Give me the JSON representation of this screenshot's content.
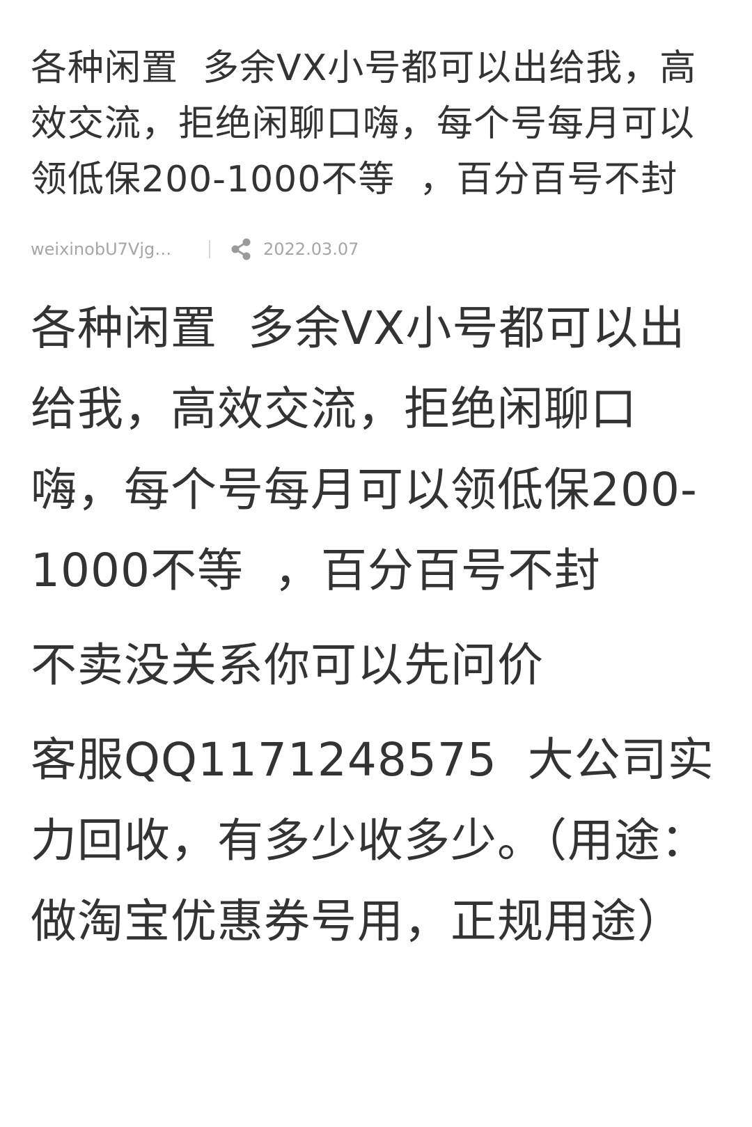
{
  "article": {
    "title": "各种闲置  多余VX小号都可以出给我，高效交流，拒绝闲聊口嗨，每个号每月可以领低保200-1000不等  ，百分百号不封",
    "author": "weixinobU7VjgHq...",
    "date": "2022.03.07",
    "share_icon": "share-icon",
    "paragraphs": [
      "各种闲置  多余VX小号都可以出给我，高效交流，拒绝闲聊口嗨，每个号每月可以领低保200-1000不等  ，百分百号不封",
      "不卖没关系你可以先问价",
      "客服QQ1171248575  大公司实力回收，有多少收多少。（用途：做淘宝优惠券号用，正规用途）"
    ]
  },
  "colors": {
    "text": "#333333",
    "meta": "#a6a6a6",
    "background": "#ffffff"
  }
}
